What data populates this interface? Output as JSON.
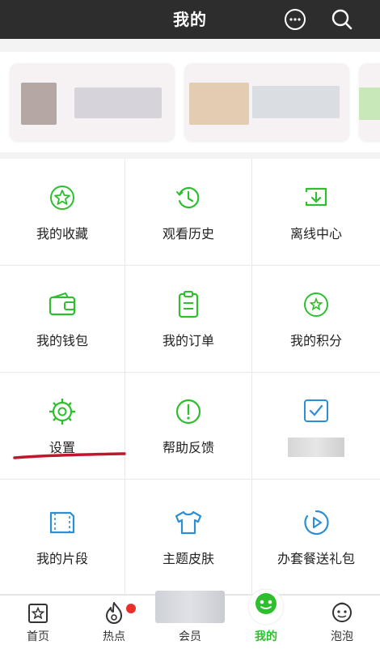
{
  "header": {
    "title": "我的",
    "chat_icon": "chat-bubble-icon",
    "search_icon": "search-icon"
  },
  "grid": [
    {
      "label": "我的收藏",
      "icon": "star-icon"
    },
    {
      "label": "观看历史",
      "icon": "history-clock-icon"
    },
    {
      "label": "离线中心",
      "icon": "download-icon"
    },
    {
      "label": "我的钱包",
      "icon": "wallet-icon"
    },
    {
      "label": "我的订单",
      "icon": "order-clipboard-icon"
    },
    {
      "label": "我的积分",
      "icon": "points-icon"
    },
    {
      "label": "设置",
      "icon": "gear-icon"
    },
    {
      "label": "帮助反馈",
      "icon": "help-icon"
    },
    {
      "label": "",
      "icon": "checkbox-icon"
    },
    {
      "label": "我的片段",
      "icon": "clip-icon"
    },
    {
      "label": "主题皮肤",
      "icon": "tshirt-icon"
    },
    {
      "label": "办套餐送礼包",
      "icon": "play-icon"
    }
  ],
  "tabbar": [
    {
      "label": "首页",
      "icon": "home-star-icon"
    },
    {
      "label": "热点",
      "icon": "flame-icon"
    },
    {
      "label": "会员",
      "icon": "vip-icon"
    },
    {
      "label": "我的",
      "icon": "mine-icon"
    },
    {
      "label": "泡泡",
      "icon": "bubble-icon"
    }
  ],
  "colors": {
    "accent": "#2dbf2d",
    "header_bg": "#2d2d2d",
    "badge_red": "#e8302b",
    "annotation_red": "#c0172e",
    "blue_icon": "#2b8fd6"
  }
}
